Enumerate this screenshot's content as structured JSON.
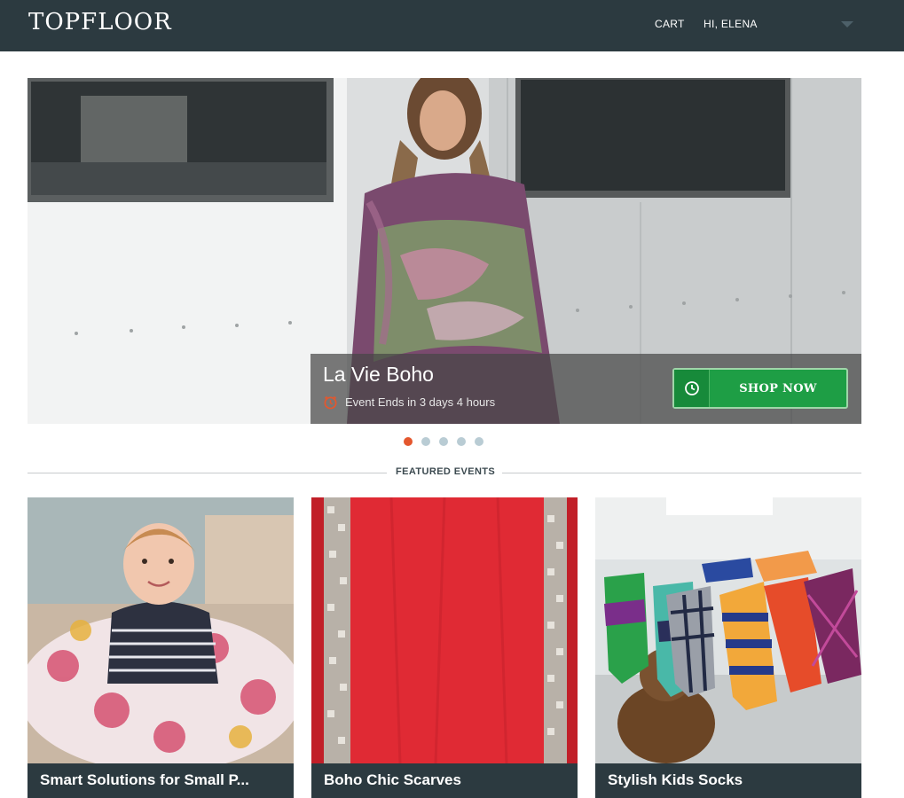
{
  "header": {
    "logo": "TOPFLOOR",
    "cart_label": "CART",
    "user_greeting": "HI, ELENA"
  },
  "hero": {
    "title": "La Vie Boho",
    "subtitle": "Event Ends in 3 days 4 hours",
    "cta_label": "SHOP NOW",
    "carousel": {
      "slide_count": 5,
      "active_index": 0
    }
  },
  "featured": {
    "heading": "FEATURED EVENTS",
    "cards": [
      {
        "title": "Smart Solutions for Small P..."
      },
      {
        "title": "Boho Chic Scarves"
      },
      {
        "title": "Stylish Kids Socks"
      }
    ]
  },
  "colors": {
    "header_bg": "#2c3a40",
    "cta_green": "#1e9e45",
    "active_dot": "#e4572e",
    "inactive_dot": "#b9ccd4"
  },
  "icons": [
    "chevron-down-icon",
    "alarm-clock-icon",
    "clock-icon"
  ]
}
